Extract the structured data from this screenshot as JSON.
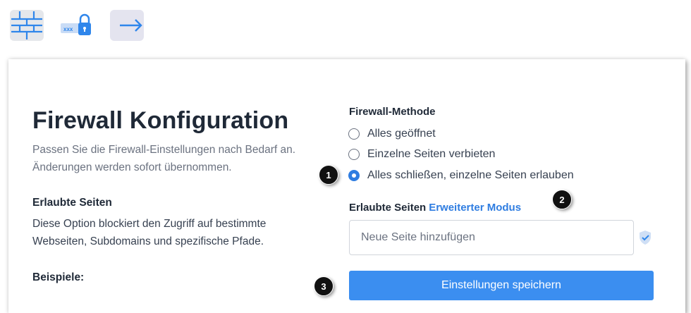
{
  "toolbar": {
    "icons": [
      "firewall-icon",
      "password-lock-icon",
      "exit-arrow-icon"
    ]
  },
  "page": {
    "title": "Firewall Konfiguration",
    "subtitle": "Passen Sie die Firewall-Einstellungen nach Bedarf an. Änderungen werden sofort übernommen.",
    "allowed_heading": "Erlaubte Seiten",
    "allowed_desc": "Diese Option blockiert den Zugriff auf bestimmte Webseiten, Subdomains und spezifische Pfade.",
    "examples_heading": "Beispiele:"
  },
  "method": {
    "label": "Firewall-Methode",
    "options": [
      {
        "label": "Alles geöffnet",
        "checked": false
      },
      {
        "label": "Einzelne Seiten verbieten",
        "checked": false
      },
      {
        "label": "Alles schließen, einzelne Seiten erlauben",
        "checked": true
      }
    ]
  },
  "allowed": {
    "label": "Erlaubte Seiten",
    "advanced_link": "Erweiterter Modus",
    "input_placeholder": "Neue Seite hinzufügen",
    "input_value": ""
  },
  "save_button": "Einstellungen speichern",
  "callouts": [
    "1",
    "2",
    "3"
  ],
  "colors": {
    "accent": "#2f7de1",
    "button": "#3b8ef0",
    "icon_blue": "#2f86eb"
  }
}
